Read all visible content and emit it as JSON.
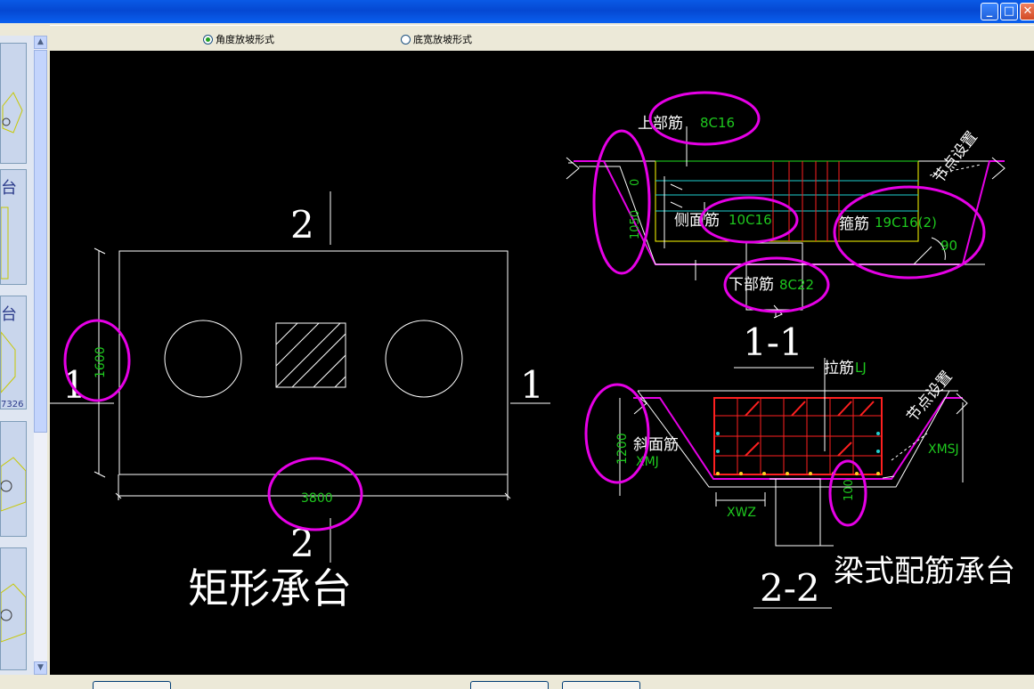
{
  "toolbar": {
    "option_angle": "角度放坡形式",
    "option_width": "底宽放坡形式"
  },
  "drawing": {
    "rect": {
      "title": "矩形承台",
      "section_top": "2",
      "section_bottom": "2",
      "section_left": "1",
      "section_right": "1",
      "height_dim": "1600",
      "width_dim": "3800"
    },
    "s11": {
      "label": "1-1",
      "top_bar": "上部筋",
      "top_bar_value": "8C16",
      "side_bar": "侧面筋",
      "side_bar_value": "10C16",
      "stirrup": "箍筋",
      "stirrup_value": "19C16(2)",
      "bottom_bar": "下部筋",
      "bottom_bar_value": "8C22",
      "node_setting": "节点设置",
      "dim_top": "0",
      "dim_height": "1050",
      "angle": "90"
    },
    "s22": {
      "label": "2-2",
      "title": "梁式配筋承台",
      "tie_bar": "拉筋",
      "tie_bar_value": "LJ",
      "slope_bar": "斜面筋",
      "slope_bar_value": "XMJ",
      "node_setting": "节点设置",
      "dim_height": "1200",
      "dim_100": "100",
      "xwz": "XWZ",
      "xmsj": "XMSJ"
    }
  },
  "colors": {
    "highlight": "#e600e6",
    "dim_text": "#1ec81e",
    "rebar": "#ff2020",
    "line": "#ffffff"
  }
}
